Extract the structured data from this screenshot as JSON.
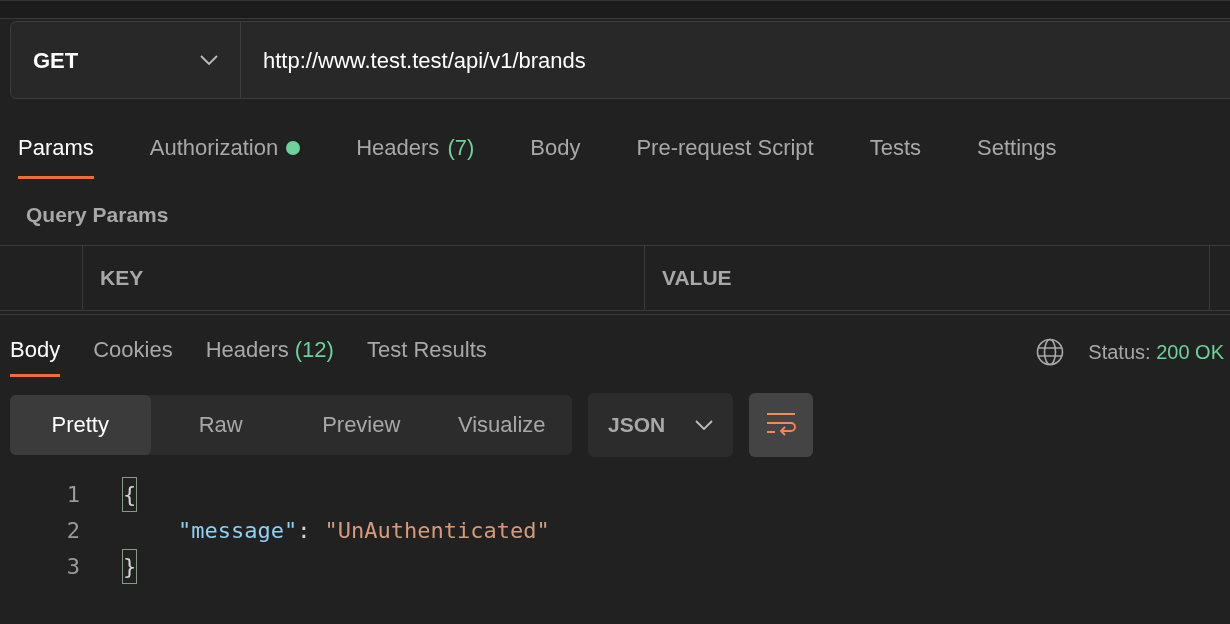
{
  "request": {
    "method": "GET",
    "url": "http://www.test.test/api/v1/brands"
  },
  "request_tabs": [
    {
      "label": "Params",
      "dot": false,
      "selected": true
    },
    {
      "label": "Authorization",
      "dot": true,
      "selected": false
    },
    {
      "label": "Headers",
      "count": "(7)",
      "dot": false,
      "selected": false
    },
    {
      "label": "Body",
      "dot": false,
      "selected": false
    },
    {
      "label": "Pre-request Script",
      "dot": false,
      "selected": false
    },
    {
      "label": "Tests",
      "dot": false,
      "selected": false
    },
    {
      "label": "Settings",
      "dot": false,
      "selected": false
    }
  ],
  "query_params": {
    "title": "Query Params",
    "columns": [
      "KEY",
      "VALUE"
    ]
  },
  "response_tabs": [
    {
      "label": "Body",
      "selected": true
    },
    {
      "label": "Cookies",
      "selected": false
    },
    {
      "label": "Headers",
      "count": "(12)",
      "selected": false
    },
    {
      "label": "Test Results",
      "selected": false
    }
  ],
  "status": {
    "label": "Status:",
    "value": "200 OK"
  },
  "view_modes": [
    {
      "label": "Pretty",
      "selected": true
    },
    {
      "label": "Raw",
      "selected": false
    },
    {
      "label": "Preview",
      "selected": false
    },
    {
      "label": "Visualize",
      "selected": false
    }
  ],
  "format": "JSON",
  "wrap_active": true,
  "code_lines": [
    {
      "number": "1",
      "tokens": [
        {
          "kind": "brace",
          "text": "{"
        }
      ]
    },
    {
      "number": "2",
      "tokens": [
        {
          "kind": "key",
          "text": "\"message\""
        },
        {
          "kind": "punct",
          "text": ":"
        },
        {
          "kind": "string",
          "text": "\"UnAuthenticated\""
        }
      ]
    },
    {
      "number": "3",
      "tokens": [
        {
          "kind": "brace",
          "text": "}"
        }
      ]
    }
  ]
}
